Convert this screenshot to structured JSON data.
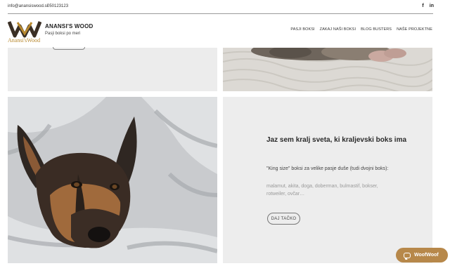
{
  "topbar": {
    "email": "info@anansiswood.si",
    "phone": "050123123",
    "social": [
      {
        "icon": "facebook-icon",
        "glyph": "f"
      },
      {
        "icon": "linkedin-icon",
        "glyph": "in"
      }
    ]
  },
  "header": {
    "logo_text": "Anansi'sWood",
    "brand": "ANANSI'S WOOD",
    "tagline": "Pasji boksi po meri",
    "nav": [
      "PASJI BOKSI",
      "ZAKAJ NAŠI BOKSI",
      "BLOG BUSTERS",
      "NAŠE PROJEKTNE"
    ]
  },
  "tile_d": {
    "title": "Jaz sem kralj sveta, ki kraljevski boks ima",
    "desc1": "\"King size\" boksi za velike pasje duše (tudi dvojni boks):",
    "desc2": "malamut, akita, doga, doberman, bulmastif, bokser, rotweiler, ovčar…",
    "cta": "DAJ TAČKO"
  },
  "chat": {
    "label": "WoofWoof"
  },
  "colors": {
    "accent": "#b7884a",
    "logo_dark": "#3a2f25",
    "logo_gold": "#b8892f"
  }
}
